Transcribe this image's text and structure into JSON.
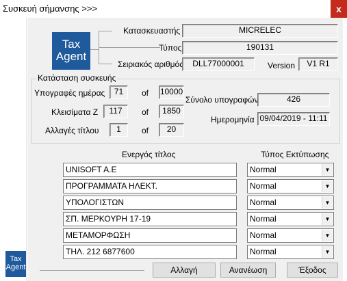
{
  "window": {
    "title": "Συσκευή σήμανσης >>>",
    "close_label": "x"
  },
  "logo": {
    "line1": "Tax",
    "line2": "Agent"
  },
  "device": {
    "manufacturer_label": "Κατασκευαστής",
    "manufacturer": "MICRELEC",
    "type_label": "Τύπος",
    "type": "190131",
    "serial_label": "Σειριακός αριθμός",
    "serial": "DLL77000001",
    "version_label": "Version",
    "version": "V1 R1"
  },
  "status": {
    "group_title": "Κατάσταση συσκευής",
    "of_label": "of",
    "rows": [
      {
        "label": "Υπογραφές ημέρας",
        "value": "71",
        "max": "10000"
      },
      {
        "label": "Κλεισίματα Ζ",
        "value": "117",
        "max": "1850"
      },
      {
        "label": "Αλλαγές τίτλου",
        "value": "1",
        "max": "20"
      }
    ],
    "total_signatures_label": "Σύνολο υπογραφών",
    "total_signatures": "426",
    "date_label": "Ημερομηνία",
    "date": "09/04/2019 - 11:11"
  },
  "titles": {
    "header_title": "Ενεργός τίτλος",
    "header_print": "Τύπος Εκτύπωσης",
    "rows": [
      {
        "text": "UNISOFT A.E",
        "print": "Normal"
      },
      {
        "text": "ΠΡΟΓΡΑΜΜΑΤΑ ΗΛΕΚΤ.",
        "print": "Normal"
      },
      {
        "text": "ΥΠΟΛΟΓΙΣΤΩΝ",
        "print": "Normal"
      },
      {
        "text": "ΣΠ. ΜΕΡΚΟΥΡΗ 17-19",
        "print": "Normal"
      },
      {
        "text": "ΜΕΤΑΜΟΡΦΩΣΗ",
        "print": "Normal"
      },
      {
        "text": "ΤΗΛ. 212 6877600",
        "print": "Normal"
      }
    ]
  },
  "buttons": {
    "change": "Αλλαγή",
    "refresh": "Ανανέωση",
    "exit": "Έξοδος"
  }
}
